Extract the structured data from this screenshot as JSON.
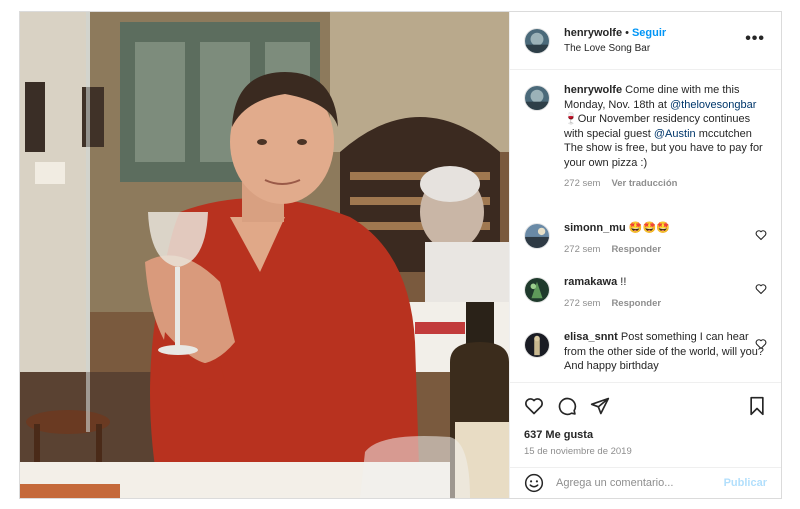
{
  "post": {
    "author": {
      "username": "henrywolfe",
      "follow_label": "Seguir",
      "separator": "•",
      "location": "The Love Song Bar"
    },
    "more_icon": "more-horizontal-icon",
    "caption": {
      "username": "henrywolfe",
      "text_1": " Come dine with me this Monday, Nov. 18th at ",
      "mention_1": "@thelovesongbar",
      "emoji_1": "🍷",
      "text_2": "Our November residency continues with special guest ",
      "mention_2": "@Austin",
      "text_3": " mccutchen The show is free, but you have to pay for your own pizza :)",
      "time": "272 sem",
      "translate_label": "Ver traducción"
    },
    "comments": [
      {
        "username": "simonn_mu",
        "text": " 🤩🤩🤩",
        "time": "272 sem",
        "reply_label": "Responder"
      },
      {
        "username": "ramakawa",
        "text": " !!",
        "time": "272 sem",
        "reply_label": "Responder"
      },
      {
        "username": "elisa_snnt",
        "text": " Post something I can hear from the other side of the world, will you? And happy birthday",
        "time": "",
        "reply_label": ""
      }
    ],
    "actions": {
      "like_icon": "heart-icon",
      "comment_icon": "comment-icon",
      "share_icon": "share-icon",
      "save_icon": "bookmark-icon"
    },
    "likes": "637 Me gusta",
    "date": "15 de noviembre de 2019",
    "add_comment": {
      "emoji_icon": "smiley-icon",
      "placeholder": "Agrega un comentario...",
      "publish_label": "Publicar"
    },
    "colors": {
      "accent": "#0095f6",
      "mention": "#00376b",
      "muted": "#8e8e8e",
      "publish_disabled": "#b2dffc"
    }
  }
}
